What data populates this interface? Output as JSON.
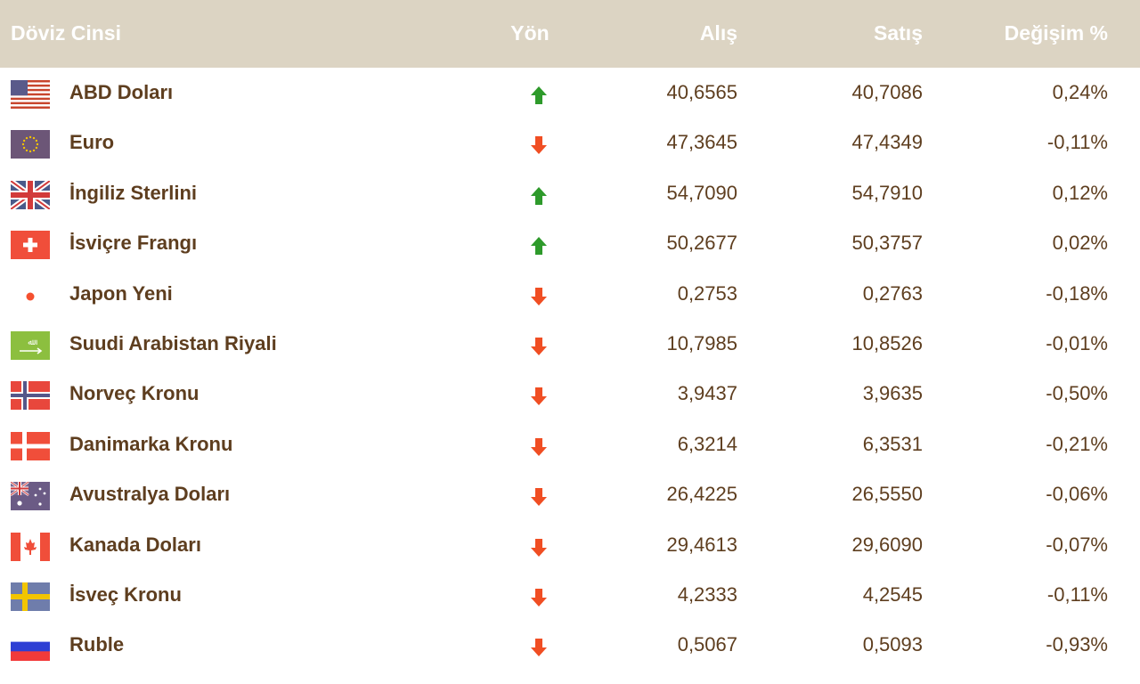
{
  "header": {
    "name": "Döviz Cinsi",
    "direction": "Yön",
    "buy": "Alış",
    "sell": "Satış",
    "change": "Değişim %"
  },
  "colors": {
    "header_bg": "#dcd4c3",
    "text": "#5e3e1f",
    "up": "#2e9a2b",
    "down": "#f04e23"
  },
  "rows": [
    {
      "name": "ABD Doları",
      "flag": "us-flag-icon",
      "direction": "up",
      "buy": "40,6565",
      "sell": "40,7086",
      "change": "0,24%"
    },
    {
      "name": "Euro",
      "flag": "eu-flag-icon",
      "direction": "down",
      "buy": "47,3645",
      "sell": "47,4349",
      "change": "-0,11%"
    },
    {
      "name": "İngiliz Sterlini",
      "flag": "uk-flag-icon",
      "direction": "up",
      "buy": "54,7090",
      "sell": "54,7910",
      "change": "0,12%"
    },
    {
      "name": "İsviçre Frangı",
      "flag": "swiss-flag-icon",
      "direction": "up",
      "buy": "50,2677",
      "sell": "50,3757",
      "change": "0,02%"
    },
    {
      "name": "Japon Yeni",
      "flag": "japan-flag-icon",
      "direction": "down",
      "buy": "0,2753",
      "sell": "0,2763",
      "change": "-0,18%"
    },
    {
      "name": "Suudi Arabistan Riyali",
      "flag": "saudi-flag-icon",
      "direction": "down",
      "buy": "10,7985",
      "sell": "10,8526",
      "change": "-0,01%"
    },
    {
      "name": "Norveç Kronu",
      "flag": "norway-flag-icon",
      "direction": "down",
      "buy": "3,9437",
      "sell": "3,9635",
      "change": "-0,50%"
    },
    {
      "name": "Danimarka Kronu",
      "flag": "denmark-flag-icon",
      "direction": "down",
      "buy": "6,3214",
      "sell": "6,3531",
      "change": "-0,21%"
    },
    {
      "name": "Avustralya Doları",
      "flag": "australia-flag-icon",
      "direction": "down",
      "buy": "26,4225",
      "sell": "26,5550",
      "change": "-0,06%"
    },
    {
      "name": "Kanada Doları",
      "flag": "canada-flag-icon",
      "direction": "down",
      "buy": "29,4613",
      "sell": "29,6090",
      "change": "-0,07%"
    },
    {
      "name": "İsveç Kronu",
      "flag": "sweden-flag-icon",
      "direction": "down",
      "buy": "4,2333",
      "sell": "4,2545",
      "change": "-0,11%"
    },
    {
      "name": "Ruble",
      "flag": "russia-flag-icon",
      "direction": "down",
      "buy": "0,5067",
      "sell": "0,5093",
      "change": "-0,93%"
    }
  ]
}
